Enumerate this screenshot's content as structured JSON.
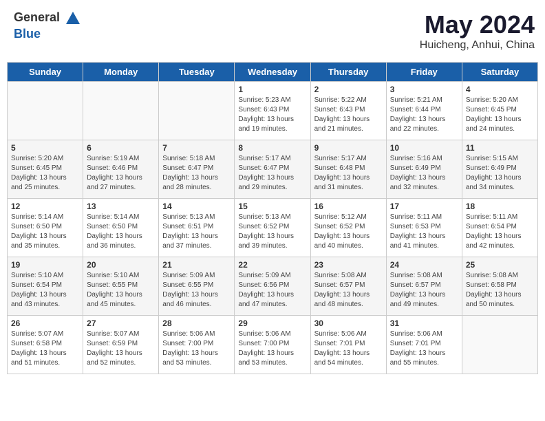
{
  "header": {
    "logo_general": "General",
    "logo_blue": "Blue",
    "month_year": "May 2024",
    "location": "Huicheng, Anhui, China"
  },
  "days_of_week": [
    "Sunday",
    "Monday",
    "Tuesday",
    "Wednesday",
    "Thursday",
    "Friday",
    "Saturday"
  ],
  "weeks": [
    [
      {
        "day": "",
        "info": ""
      },
      {
        "day": "",
        "info": ""
      },
      {
        "day": "",
        "info": ""
      },
      {
        "day": "1",
        "info": "Sunrise: 5:23 AM\nSunset: 6:43 PM\nDaylight: 13 hours\nand 19 minutes."
      },
      {
        "day": "2",
        "info": "Sunrise: 5:22 AM\nSunset: 6:43 PM\nDaylight: 13 hours\nand 21 minutes."
      },
      {
        "day": "3",
        "info": "Sunrise: 5:21 AM\nSunset: 6:44 PM\nDaylight: 13 hours\nand 22 minutes."
      },
      {
        "day": "4",
        "info": "Sunrise: 5:20 AM\nSunset: 6:45 PM\nDaylight: 13 hours\nand 24 minutes."
      }
    ],
    [
      {
        "day": "5",
        "info": "Sunrise: 5:20 AM\nSunset: 6:45 PM\nDaylight: 13 hours\nand 25 minutes."
      },
      {
        "day": "6",
        "info": "Sunrise: 5:19 AM\nSunset: 6:46 PM\nDaylight: 13 hours\nand 27 minutes."
      },
      {
        "day": "7",
        "info": "Sunrise: 5:18 AM\nSunset: 6:47 PM\nDaylight: 13 hours\nand 28 minutes."
      },
      {
        "day": "8",
        "info": "Sunrise: 5:17 AM\nSunset: 6:47 PM\nDaylight: 13 hours\nand 29 minutes."
      },
      {
        "day": "9",
        "info": "Sunrise: 5:17 AM\nSunset: 6:48 PM\nDaylight: 13 hours\nand 31 minutes."
      },
      {
        "day": "10",
        "info": "Sunrise: 5:16 AM\nSunset: 6:49 PM\nDaylight: 13 hours\nand 32 minutes."
      },
      {
        "day": "11",
        "info": "Sunrise: 5:15 AM\nSunset: 6:49 PM\nDaylight: 13 hours\nand 34 minutes."
      }
    ],
    [
      {
        "day": "12",
        "info": "Sunrise: 5:14 AM\nSunset: 6:50 PM\nDaylight: 13 hours\nand 35 minutes."
      },
      {
        "day": "13",
        "info": "Sunrise: 5:14 AM\nSunset: 6:50 PM\nDaylight: 13 hours\nand 36 minutes."
      },
      {
        "day": "14",
        "info": "Sunrise: 5:13 AM\nSunset: 6:51 PM\nDaylight: 13 hours\nand 37 minutes."
      },
      {
        "day": "15",
        "info": "Sunrise: 5:13 AM\nSunset: 6:52 PM\nDaylight: 13 hours\nand 39 minutes."
      },
      {
        "day": "16",
        "info": "Sunrise: 5:12 AM\nSunset: 6:52 PM\nDaylight: 13 hours\nand 40 minutes."
      },
      {
        "day": "17",
        "info": "Sunrise: 5:11 AM\nSunset: 6:53 PM\nDaylight: 13 hours\nand 41 minutes."
      },
      {
        "day": "18",
        "info": "Sunrise: 5:11 AM\nSunset: 6:54 PM\nDaylight: 13 hours\nand 42 minutes."
      }
    ],
    [
      {
        "day": "19",
        "info": "Sunrise: 5:10 AM\nSunset: 6:54 PM\nDaylight: 13 hours\nand 43 minutes."
      },
      {
        "day": "20",
        "info": "Sunrise: 5:10 AM\nSunset: 6:55 PM\nDaylight: 13 hours\nand 45 minutes."
      },
      {
        "day": "21",
        "info": "Sunrise: 5:09 AM\nSunset: 6:55 PM\nDaylight: 13 hours\nand 46 minutes."
      },
      {
        "day": "22",
        "info": "Sunrise: 5:09 AM\nSunset: 6:56 PM\nDaylight: 13 hours\nand 47 minutes."
      },
      {
        "day": "23",
        "info": "Sunrise: 5:08 AM\nSunset: 6:57 PM\nDaylight: 13 hours\nand 48 minutes."
      },
      {
        "day": "24",
        "info": "Sunrise: 5:08 AM\nSunset: 6:57 PM\nDaylight: 13 hours\nand 49 minutes."
      },
      {
        "day": "25",
        "info": "Sunrise: 5:08 AM\nSunset: 6:58 PM\nDaylight: 13 hours\nand 50 minutes."
      }
    ],
    [
      {
        "day": "26",
        "info": "Sunrise: 5:07 AM\nSunset: 6:58 PM\nDaylight: 13 hours\nand 51 minutes."
      },
      {
        "day": "27",
        "info": "Sunrise: 5:07 AM\nSunset: 6:59 PM\nDaylight: 13 hours\nand 52 minutes."
      },
      {
        "day": "28",
        "info": "Sunrise: 5:06 AM\nSunset: 7:00 PM\nDaylight: 13 hours\nand 53 minutes."
      },
      {
        "day": "29",
        "info": "Sunrise: 5:06 AM\nSunset: 7:00 PM\nDaylight: 13 hours\nand 53 minutes."
      },
      {
        "day": "30",
        "info": "Sunrise: 5:06 AM\nSunset: 7:01 PM\nDaylight: 13 hours\nand 54 minutes."
      },
      {
        "day": "31",
        "info": "Sunrise: 5:06 AM\nSunset: 7:01 PM\nDaylight: 13 hours\nand 55 minutes."
      },
      {
        "day": "",
        "info": ""
      }
    ]
  ]
}
